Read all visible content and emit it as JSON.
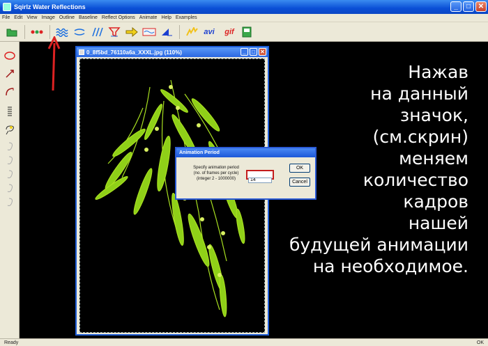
{
  "window": {
    "title": "Sqirlz Water Reflections"
  },
  "menu": [
    "File",
    "Edit",
    "View",
    "Image",
    "Outline",
    "Baseline",
    "Reflect Options",
    "Animate",
    "Help",
    "Examples"
  ],
  "toolbar": {
    "avi_label": "avi",
    "gif_label": "gif"
  },
  "image_window": {
    "title": "0_8f5bd_76110a6a_XXXL.jpg  (110%)"
  },
  "dialog": {
    "title": "Animation Period",
    "prompt_line1": "Specify animation period",
    "prompt_line2": "(no. of frames per cycle)",
    "prompt_line3": "(integer 2 - 1000000)",
    "value": "14",
    "ok_label": "OK",
    "cancel_label": "Cancel"
  },
  "caption": {
    "lines": [
      "Нажав",
      "на данный",
      "значок,",
      "(см.скрин)",
      "меняем",
      "количество",
      "кадров",
      "нашей",
      "будущей анимации",
      "на необходимое."
    ]
  },
  "status": {
    "left": "Ready",
    "right": "OK"
  },
  "colors": {
    "title_blue": "#0a4fd6",
    "chrome": "#ece9d8",
    "highlight_red": "#c41c1c",
    "plant_green": "#a8e020"
  }
}
